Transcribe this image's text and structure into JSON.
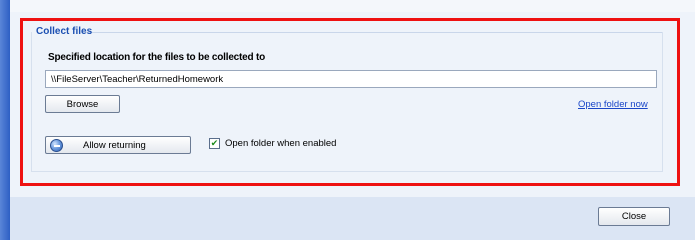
{
  "group": {
    "title": "Collect files"
  },
  "location": {
    "label": "Specified location for the files to be collected to",
    "path": "\\\\FileServer\\Teacher\\ReturnedHomework"
  },
  "buttons": {
    "browse": "Browse",
    "allow_returning": "Allow returning",
    "close": "Close"
  },
  "links": {
    "open_folder_now": "Open folder now"
  },
  "options": {
    "open_folder_when_enabled": {
      "label": "Open folder when enabled",
      "checked": true
    }
  },
  "icons": {
    "allow_returning": "globe-icon",
    "checkbox": "check-icon"
  },
  "colors": {
    "highlight": "#ee1111",
    "group_title": "#1b4fb2",
    "link": "#1a46c8"
  }
}
